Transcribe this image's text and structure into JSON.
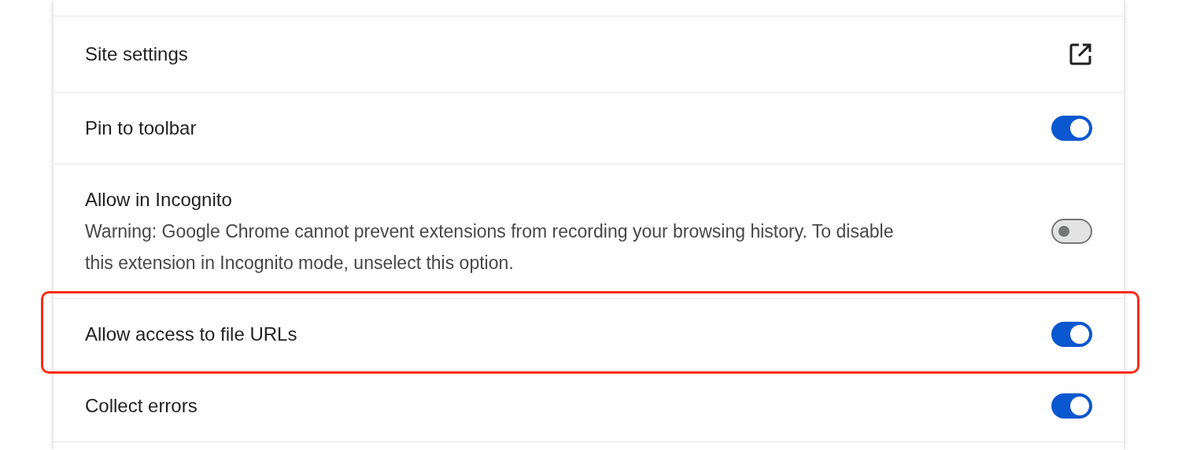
{
  "settings": [
    {
      "kind": "link",
      "label": "Site settings"
    },
    {
      "kind": "toggle",
      "label": "Pin to toolbar",
      "on": true,
      "highlighted": false
    },
    {
      "kind": "toggle",
      "label": "Allow in Incognito",
      "description": "Warning: Google Chrome cannot prevent extensions from recording your browsing history. To disable this extension in Incognito mode, unselect this option.",
      "on": false,
      "highlighted": false
    },
    {
      "kind": "toggle",
      "label": "Allow access to file URLs",
      "on": true,
      "highlighted": true
    },
    {
      "kind": "toggle",
      "label": "Collect errors",
      "on": true,
      "highlighted": false
    }
  ]
}
